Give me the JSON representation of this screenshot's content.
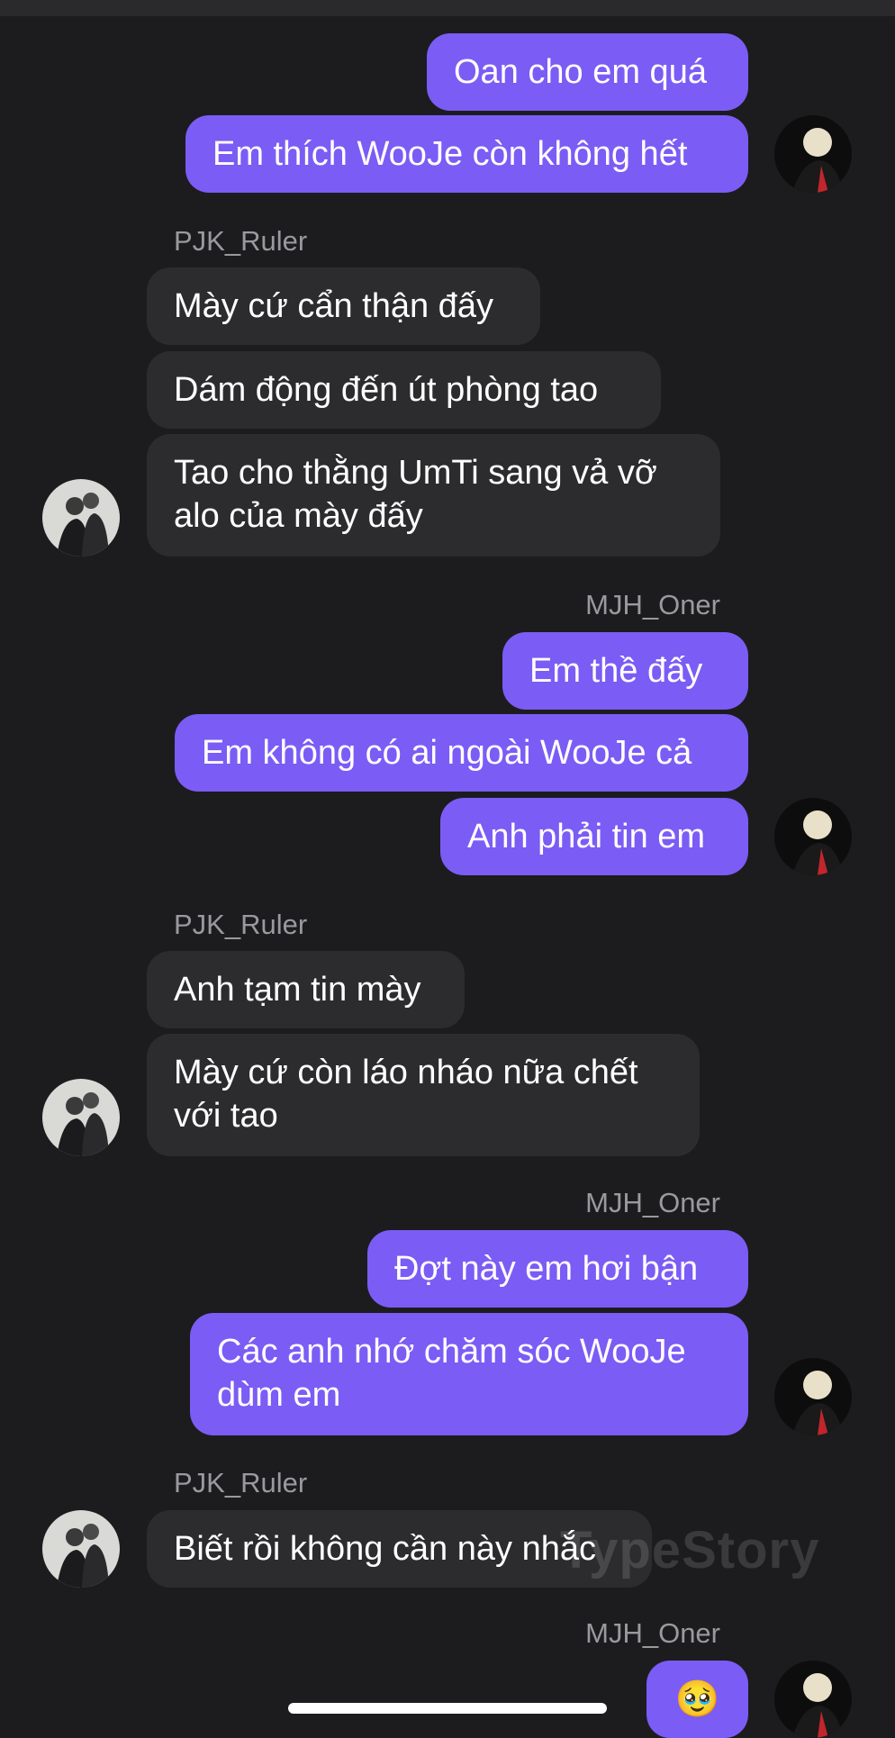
{
  "conversation": {
    "messages": [
      {
        "id": "m1",
        "from": "MJH_Oner",
        "text": "Oan cho em quá"
      },
      {
        "id": "m2",
        "from": "MJH_Oner",
        "text": "Em thích WooJe còn không hết"
      },
      {
        "id": "m3",
        "from": "PJK_Ruler",
        "text": "Mày cứ cẩn thận đấy"
      },
      {
        "id": "m4",
        "from": "PJK_Ruler",
        "text": "Dám động đến út phòng tao"
      },
      {
        "id": "m5",
        "from": "PJK_Ruler",
        "text": "Tao cho thằng UmTi sang vả vỡ alo của mày đấy"
      },
      {
        "id": "m6",
        "from": "MJH_Oner",
        "text": "Em thề đấy"
      },
      {
        "id": "m7",
        "from": "MJH_Oner",
        "text": "Em không có ai ngoài WooJe cả"
      },
      {
        "id": "m8",
        "from": "MJH_Oner",
        "text": "Anh phải tin em"
      },
      {
        "id": "m9",
        "from": "PJK_Ruler",
        "text": "Anh tạm tin mày"
      },
      {
        "id": "m10",
        "from": "PJK_Ruler",
        "text": "Mày cứ còn láo nháo nữa chết với tao"
      },
      {
        "id": "m11",
        "from": "MJH_Oner",
        "text": "Đợt này em hơi bận"
      },
      {
        "id": "m12",
        "from": "MJH_Oner",
        "text": "Các anh nhớ chăm sóc WooJe dùm em"
      },
      {
        "id": "m13",
        "from": "PJK_Ruler",
        "text": "Biết rồi không cần này nhắc"
      },
      {
        "id": "m14",
        "from": "MJH_Oner",
        "text": "🥹"
      }
    ],
    "sender_labels": {
      "s1": "PJK_Ruler",
      "s2": "MJH_Oner",
      "s3": "PJK_Ruler",
      "s4": "MJH_Oner",
      "s5": "PJK_Ruler",
      "s6": "MJH_Oner"
    }
  },
  "watermark": "TypeStory",
  "colors": {
    "background": "#1c1c1e",
    "outgoing_bubble": "#7b5cf5",
    "incoming_bubble": "#2c2c2e",
    "sender_text": "#9a9a9e"
  },
  "icons": {
    "oner_avatar": "avatar-oner-icon",
    "ruler_avatar": "avatar-ruler-icon"
  }
}
